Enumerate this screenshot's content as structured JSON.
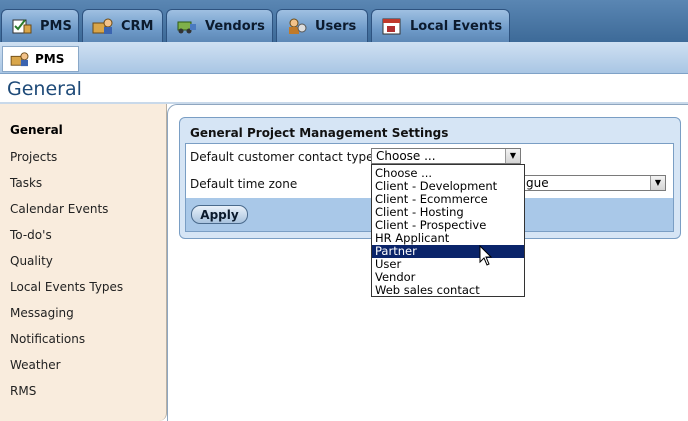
{
  "tabs": [
    {
      "label": "PMS",
      "icon": "pms-icon"
    },
    {
      "label": "CRM",
      "icon": "crm-icon"
    },
    {
      "label": "Vendors",
      "icon": "vendors-icon"
    },
    {
      "label": "Users",
      "icon": "users-icon"
    },
    {
      "label": "Local Events",
      "icon": "calendar-icon"
    }
  ],
  "subtab": {
    "label": "PMS"
  },
  "page_title": "General",
  "sidebar": {
    "items": [
      "General",
      "Projects",
      "Tasks",
      "Calendar Events",
      "To-do's",
      "Quality",
      "Local Events Types",
      "Messaging",
      "Notifications",
      "Weather",
      "RMS"
    ],
    "active": "General"
  },
  "panel": {
    "title": "General Project Management Settings",
    "contact_label": "Default customer contact type",
    "contact_value": "Choose ...",
    "timezone_label": "Default time zone",
    "timezone_value_visible": "gue",
    "apply_label": "Apply"
  },
  "dropdown": {
    "options": [
      "Choose ...",
      "Client - Development",
      "Client - Ecommerce",
      "Client - Hosting",
      "Client - Prospective",
      "HR Applicant",
      "Partner",
      "User",
      "Vendor",
      "Web sales contact"
    ],
    "highlighted": "Partner"
  },
  "colors": {
    "tab_bar": "#3d6a98",
    "highlight": "#0a246a",
    "sidebar_bg": "#f9ecdd",
    "panel_bg": "#d6e5f5"
  }
}
